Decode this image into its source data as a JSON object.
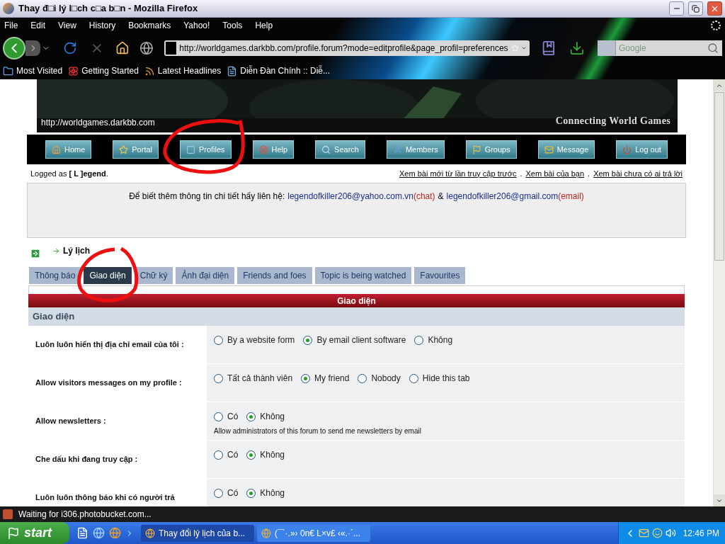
{
  "window": {
    "title": "Thay đ□i lý l□ch c□a b□n - Mozilla Firefox"
  },
  "menu": [
    "File",
    "Edit",
    "View",
    "History",
    "Bookmarks",
    "Yahoo!",
    "Tools",
    "Help"
  ],
  "address": "http://worldgames.darkbb.com/profile.forum?mode=editprofile&page_profil=preferences",
  "search": {
    "placeholder": "Google"
  },
  "bookmarks": [
    "Most Visited",
    "Getting Started",
    "Latest Headlines",
    "Diễn Đàn Chính :: Diễ..."
  ],
  "banner": {
    "url": "http://worldgames.darkbb.com",
    "tagline": "Connecting World Games"
  },
  "nav": [
    "Home",
    "Portal",
    "Profiles",
    "Help",
    "Search",
    "Members",
    "Groups",
    "Message",
    "Log out"
  ],
  "logged": "Logged as **[ L ]egend**.",
  "quick_links": [
    "Xem bài mới từ lần truy cập trước",
    "Xem bài của bạn",
    "Xem bài chưa có ai trả lời"
  ],
  "quick_link_separators": [
    ".",
    "."
  ],
  "notice": {
    "text": "Để biết thêm thông tin chi tiết hấy liên hệ:",
    "yahoo": "legendofkiller206@yahoo.com.vn",
    "chat": "(chat)",
    "amp": "&",
    "gmail": "legendofkiller206@gmail.com",
    "email": "(email)"
  },
  "breadcrumb": "Lý lịch",
  "tabs": [
    {
      "label": "Thông báo",
      "selected": false
    },
    {
      "label": "Giao diện",
      "selected": true
    },
    {
      "label": "Chữ ký",
      "selected": false
    },
    {
      "label": "Ảnh đại diện",
      "selected": false
    },
    {
      "label": "Friends and foes",
      "selected": false
    },
    {
      "label": "Topic is being watched",
      "selected": false
    },
    {
      "label": "Favourites",
      "selected": false
    }
  ],
  "panel": {
    "title": "Giao diện",
    "section": "Giao diện",
    "rows": [
      {
        "label": "Luôn luôn hiển thị địa chỉ email của tôi :",
        "options": [
          {
            "label": "By a website form",
            "selected": false
          },
          {
            "label": "By email client software",
            "selected": true
          },
          {
            "label": "Không",
            "selected": false
          }
        ]
      },
      {
        "label": "Allow visitors messages on my profile :",
        "options": [
          {
            "label": "Tất cả thành viên",
            "selected": false
          },
          {
            "label": "My friend",
            "selected": true
          },
          {
            "label": "Nobody",
            "selected": false
          },
          {
            "label": "Hide this tab",
            "selected": false
          }
        ]
      },
      {
        "label": "Allow newsletters :",
        "options": [
          {
            "label": "Có",
            "selected": false
          },
          {
            "label": "Không",
            "selected": true
          }
        ],
        "note": "Allow administrators of this forum to send me newsletters by email"
      },
      {
        "label": "Che dấu khi đang truy cập :",
        "options": [
          {
            "label": "Có",
            "selected": false
          },
          {
            "label": "Không",
            "selected": true
          }
        ]
      },
      {
        "label": "Luôn luôn thông báo khi có người trả",
        "options": [
          {
            "label": "Có",
            "selected": false
          },
          {
            "label": "Không",
            "selected": true
          }
        ]
      }
    ]
  },
  "status": "Waiting for i306.photobucket.com...",
  "taskbar": {
    "start": "start",
    "tasks": [
      {
        "label": "Thay đổi lý lịch của b...",
        "selected": true
      },
      {
        "label": "(¯`·.»› 0n€ L×v£ ‹«.·´...",
        "selected": false
      }
    ],
    "clock": "12:46 PM"
  }
}
